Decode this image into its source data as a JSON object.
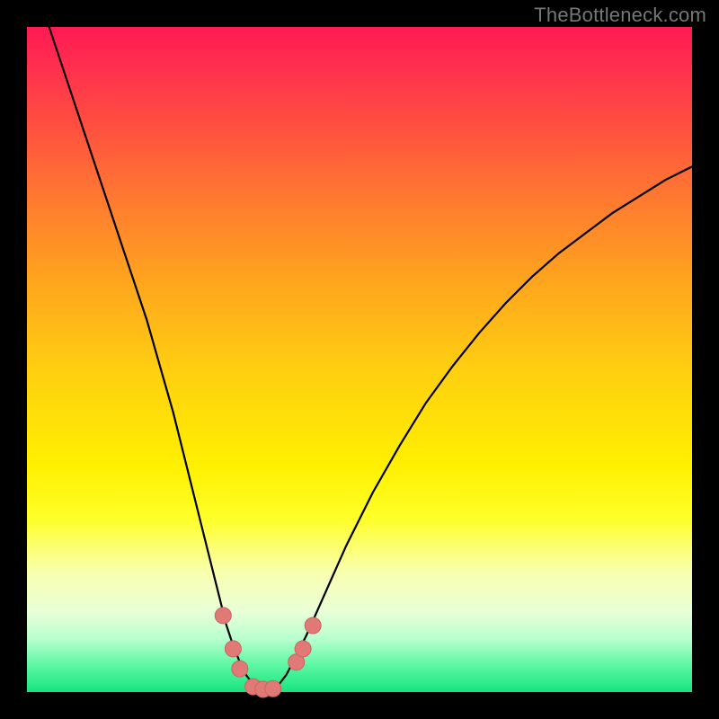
{
  "watermark": {
    "text": "TheBottleneck.com"
  },
  "colors": {
    "frame": "#000000",
    "curve": "#000000",
    "marker_fill": "#e17a76",
    "marker_stroke": "#c96560"
  },
  "chart_data": {
    "type": "line",
    "title": "",
    "xlabel": "",
    "ylabel": "",
    "xlim": [
      0,
      100
    ],
    "ylim": [
      0,
      100
    ],
    "grid": false,
    "legend": null,
    "x": [
      0,
      2,
      4,
      6,
      8,
      10,
      12,
      14,
      16,
      18,
      20,
      22,
      24,
      26,
      28,
      30,
      31,
      32,
      33,
      34,
      35,
      36,
      37,
      38,
      39,
      40,
      42,
      44,
      46,
      48,
      50,
      52,
      56,
      60,
      64,
      68,
      72,
      76,
      80,
      84,
      88,
      92,
      96,
      100
    ],
    "series": [
      {
        "name": "bottleneck",
        "values": [
          110,
          104,
          98,
          92,
          86,
          80,
          74,
          68,
          62,
          56,
          49,
          42,
          34,
          26,
          18,
          10,
          7,
          4.5,
          2.5,
          1.2,
          0.6,
          0.5,
          0.6,
          1.3,
          2.6,
          4.5,
          8.5,
          13,
          17.5,
          22,
          26,
          30,
          37,
          43.5,
          49,
          54,
          58.5,
          62.5,
          66,
          69,
          72,
          74.5,
          77,
          79
        ]
      }
    ],
    "markers": [
      {
        "x": 29.5,
        "y": 11.5
      },
      {
        "x": 31.0,
        "y": 6.5
      },
      {
        "x": 32.0,
        "y": 3.5
      },
      {
        "x": 34.0,
        "y": 0.8
      },
      {
        "x": 35.5,
        "y": 0.4
      },
      {
        "x": 37.0,
        "y": 0.5
      },
      {
        "x": 40.5,
        "y": 4.5
      },
      {
        "x": 41.5,
        "y": 6.5
      },
      {
        "x": 43.0,
        "y": 10.0
      }
    ],
    "marker_radius_px": 9
  }
}
